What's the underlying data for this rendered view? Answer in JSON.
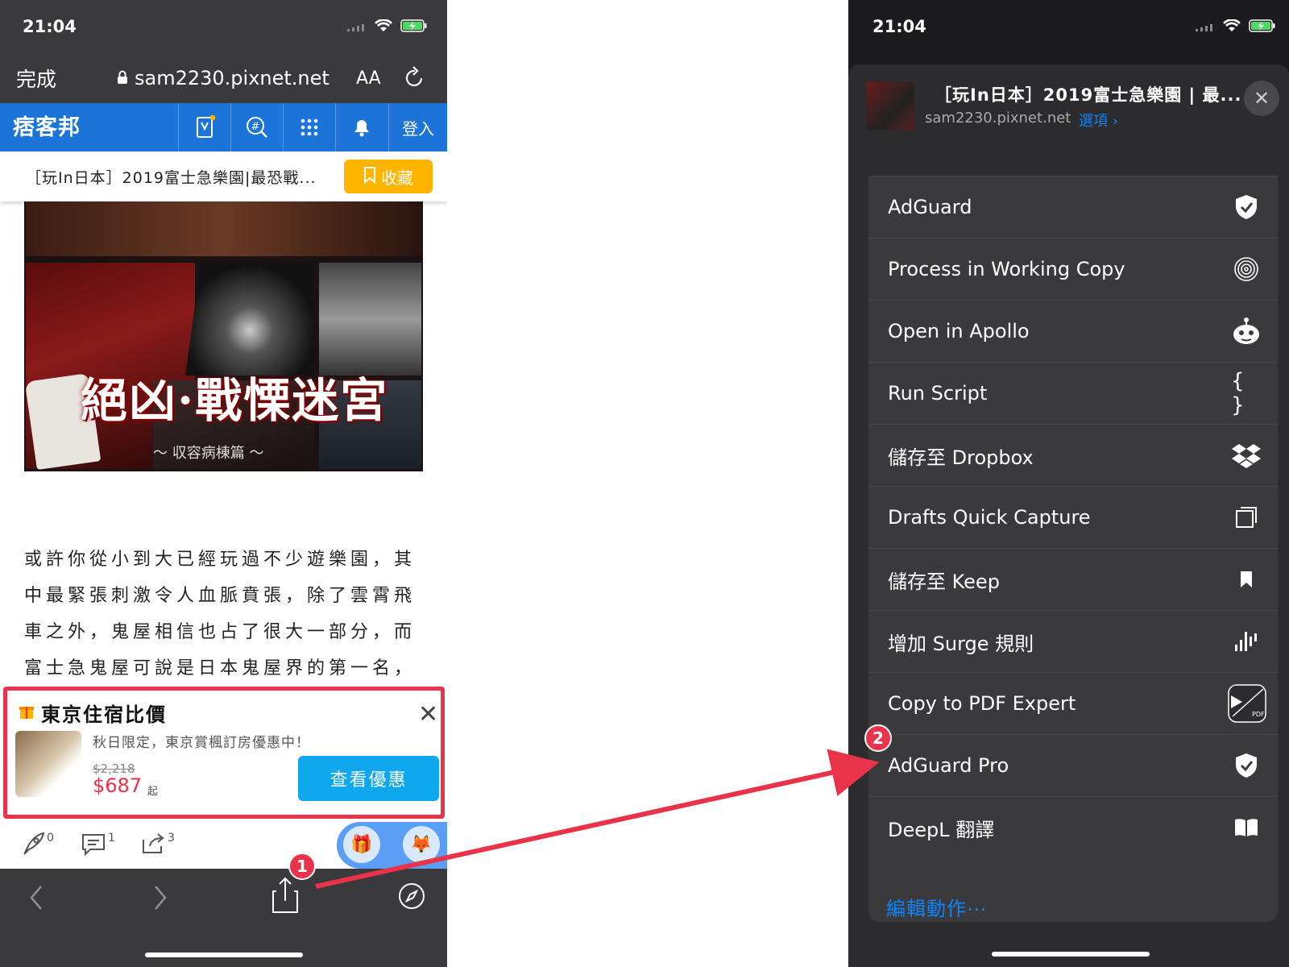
{
  "status": {
    "time": "21:04"
  },
  "safari": {
    "done_label": "完成",
    "url": "sam2230.pixnet.net",
    "text_size_label": "AA"
  },
  "pixnet": {
    "logo": "痞客邦",
    "login_label": "登入"
  },
  "article": {
    "title": "［玩In日本］2019富士急樂園|最恐戰...",
    "collect_label": "收藏",
    "hero_title": "絕凶·戰慄迷宮",
    "hero_subtitle": "～ 収容病棟篇 ～",
    "paragraph": [
      "或許你從小到大已經玩過不少遊樂園，其",
      "中最緊張刺激令人血脈賁張，除了雲霄飛",
      "車之外，鬼屋相信也占了很大一部分，而",
      "富士急鬼屋可說是日本鬼屋界的第一名，"
    ]
  },
  "ad": {
    "title": "東京住宿比價",
    "desc": "秋日限定，東京賞楓訂房優惠中！",
    "old_price": "$2,218",
    "new_price": "$687",
    "price_suffix": "起",
    "button": "查看優惠"
  },
  "toolbar": {
    "likes": "0",
    "comments": "1",
    "shares": "3"
  },
  "sheet": {
    "title": "［玩In日本］2019富士急樂園 | 最...",
    "url": "sam2230.pixnet.net",
    "options": "選項 ›",
    "actions": [
      {
        "label": "AdGuard",
        "icon": "shield-check-icon"
      },
      {
        "label": "Process in Working Copy",
        "icon": "fingerprint-icon"
      },
      {
        "label": "Open in Apollo",
        "icon": "apollo-robot-icon"
      },
      {
        "label": "Run Script",
        "icon": "braces-icon"
      },
      {
        "label": "儲存至 Dropbox",
        "icon": "dropbox-icon"
      },
      {
        "label": "Drafts Quick Capture",
        "icon": "drafts-icon"
      },
      {
        "label": "儲存至 Keep",
        "icon": "bookmark-icon"
      },
      {
        "label": "增加 Surge 規則",
        "icon": "surge-icon"
      },
      {
        "label": "Copy to PDF Expert",
        "icon": "pdf-expert-icon"
      },
      {
        "label": "AdGuard Pro",
        "icon": "shield-check-icon"
      },
      {
        "label": "DeepL 翻譯",
        "icon": "book-icon"
      }
    ],
    "edit_label": "編輯動作⋯"
  },
  "annotations": {
    "step1": "1",
    "step2": "2"
  },
  "colors": {
    "annotation": "#e8334a",
    "pixnet_blue": "#1c74d9",
    "ios_blue": "#0a84ff",
    "collect_yellow": "#ffb400"
  }
}
